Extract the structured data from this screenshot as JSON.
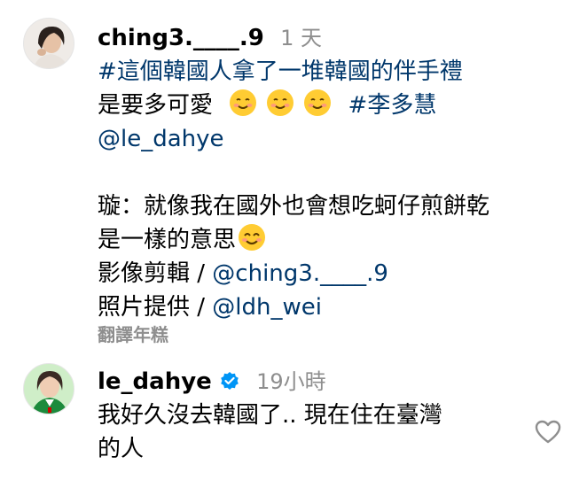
{
  "comment1": {
    "username": "ching3.____.9",
    "time": "1 天",
    "hashtag_line": "#這個韓國人拿了一堆韓國的伴手禮",
    "line2_text": "是要多可愛",
    "line2_hashtag": "#李多慧",
    "mention": "@le_dahye",
    "line4": "璇：就像我在國外也會想吃蚵仔煎餅乾",
    "line5": "是一樣的意思",
    "video_credit_label": "影像剪輯 / ",
    "video_credit_mention": "@ching3.____.9",
    "photo_credit_label": "照片提供 / ",
    "photo_credit_mention": "@ldh_wei",
    "translate": "翻譯年糕"
  },
  "comment2": {
    "username": "le_dahye",
    "time": "19小時",
    "line1": "我好久沒去韓國了.. 現在住在臺灣",
    "line2": "的人"
  },
  "colors": {
    "link": "#00376b",
    "muted": "#8e8e8e",
    "verified": "#0095f6"
  },
  "icons": {
    "comment1_emojis": [
      "smiling-face-icon",
      "smiling-face-icon",
      "smiling-face-icon"
    ],
    "comment1_end_emoji": "smiling-face-with-smiling-eyes-icon",
    "verified": "verified-badge-icon",
    "like": "heart-outline-icon"
  }
}
